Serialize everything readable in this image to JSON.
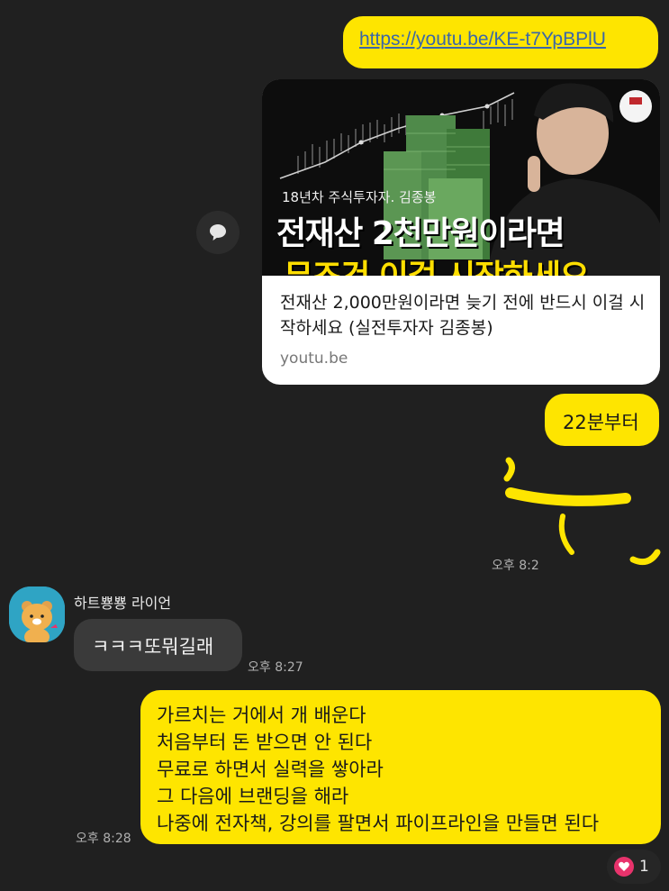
{
  "messages": {
    "link": {
      "text": "https://youtu.be/KE-t7YpBPlU"
    },
    "preview": {
      "thumb_subtitle": "18년차 주식투자자. 김종봉",
      "thumb_title_line1": "전재산 2천만원이라면",
      "thumb_title_line2": "무조건 이걸 시작하세요",
      "title": "전재산 2,000만원이라면 늦기 전에 반드시 이걸 시작하세요 (실전투자자 김종봉)",
      "domain": "youtu.be"
    },
    "from22": {
      "text": "22분부터"
    },
    "redacted_time": "오후 8:2",
    "other": {
      "sender": "하트뿅뿅 라이언",
      "text": "ㅋㅋㅋ또뭐길래",
      "time": "오후 8:27"
    },
    "long": {
      "lines": [
        "가르치는 거에서 개 배운다",
        "처음부터 돈 받으면 안 된다",
        "무료로 하면서 실력을 쌓아라",
        "그 다음에 브랜딩을 해라",
        "나중에 전자책, 강의를 팔면서 파이프라인을 만들면 된다"
      ],
      "time": "오후 8:28",
      "reaction_count": "1"
    }
  },
  "colors": {
    "background": "#202020",
    "my_bubble": "#fee500",
    "other_bubble": "#3a3a3a",
    "link": "#3b67a8",
    "reaction": "#e8336c"
  }
}
